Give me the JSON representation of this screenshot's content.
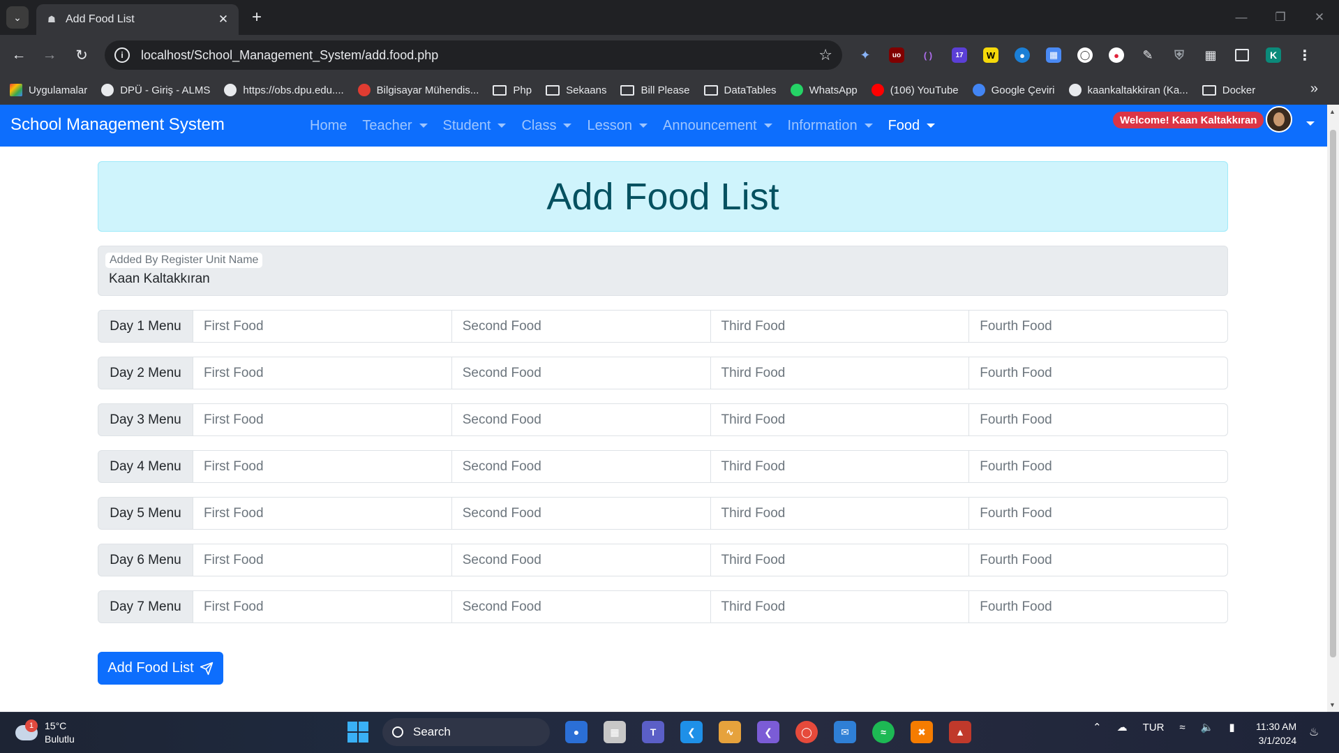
{
  "browser": {
    "tab_title": "Add Food List",
    "url": "localhost/School_Management_System/add.food.php",
    "bookmarks": [
      {
        "label": "Uygulamalar",
        "icon": "apps-grid-icon"
      },
      {
        "label": "DPÜ - Giriş - ALMS",
        "icon": "globe-icon"
      },
      {
        "label": "https://obs.dpu.edu....",
        "icon": "globe-icon"
      },
      {
        "label": "Bilgisayar Mühendis...",
        "icon": "site-icon"
      },
      {
        "label": "Php",
        "icon": "folder-icon"
      },
      {
        "label": "Sekaans",
        "icon": "folder-icon"
      },
      {
        "label": "Bill Please",
        "icon": "folder-icon"
      },
      {
        "label": "DataTables",
        "icon": "folder-icon"
      },
      {
        "label": "WhatsApp",
        "icon": "whatsapp-icon"
      },
      {
        "label": "(106) YouTube",
        "icon": "youtube-icon"
      },
      {
        "label": "Google Çeviri",
        "icon": "translate-icon"
      },
      {
        "label": "kaankaltakkiran (Ka...",
        "icon": "github-icon"
      },
      {
        "label": "Docker",
        "icon": "folder-icon"
      }
    ],
    "extension_badge": "17",
    "profile_initial": "K"
  },
  "navbar": {
    "brand": "School Management System",
    "items": [
      {
        "label": "Home",
        "dropdown": false
      },
      {
        "label": "Teacher",
        "dropdown": true
      },
      {
        "label": "Student",
        "dropdown": true
      },
      {
        "label": "Class",
        "dropdown": true
      },
      {
        "label": "Lesson",
        "dropdown": true
      },
      {
        "label": "Announcement",
        "dropdown": true
      },
      {
        "label": "Information",
        "dropdown": true
      },
      {
        "label": "Food",
        "dropdown": true,
        "active": true
      }
    ],
    "welcome": "Welcome! Kaan Kaltakkıran"
  },
  "page": {
    "heading": "Add Food List",
    "added_by": {
      "label": "Added By Register Unit Name",
      "value": "Kaan Kaltakkıran"
    },
    "menu_rows": [
      {
        "label": "Day 1 Menu"
      },
      {
        "label": "Day 2 Menu"
      },
      {
        "label": "Day 3 Menu"
      },
      {
        "label": "Day 4 Menu"
      },
      {
        "label": "Day 5 Menu"
      },
      {
        "label": "Day 6 Menu"
      },
      {
        "label": "Day 7 Menu"
      }
    ],
    "food_placeholders": [
      "First Food",
      "Second Food",
      "Third Food",
      "Fourth Food"
    ],
    "submit_label": "Add Food List"
  },
  "taskbar": {
    "temperature": "15°C",
    "weather": "Bulutlu",
    "weather_badge": "1",
    "search_label": "Search",
    "language": "TUR",
    "time": "11:30 AM",
    "date": "3/1/2024"
  },
  "colors": {
    "primary": "#0d6efd",
    "alert_bg": "#cff4fc",
    "alert_text": "#055160",
    "badge_red": "#dc3545"
  }
}
